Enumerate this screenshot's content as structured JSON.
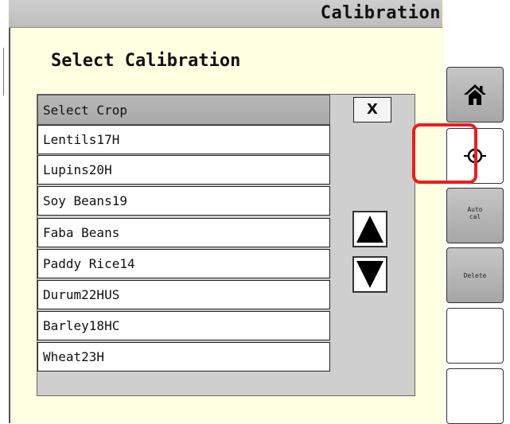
{
  "window": {
    "title": "Calibration"
  },
  "dialog": {
    "heading": "Select Calibration",
    "list_header": "Select Crop",
    "close_label": "X",
    "crops": [
      "Lentils17H",
      "Lupins20H",
      "Soy Beans19",
      "Faba Beans",
      "Paddy Rice14",
      "Durum22HUS",
      "Barley18HC",
      "Wheat23H"
    ]
  },
  "sidebar": {
    "home": {
      "icon": "home-icon"
    },
    "target": {
      "icon": "target-icon"
    },
    "autocal": {
      "line1": "Auto",
      "line2": "cal"
    },
    "delete": {
      "label": "Delete"
    }
  },
  "colors": {
    "panel_background": "#ffffe1",
    "highlight": "#ee1c1c",
    "title_bar": "#c8c8c8"
  }
}
